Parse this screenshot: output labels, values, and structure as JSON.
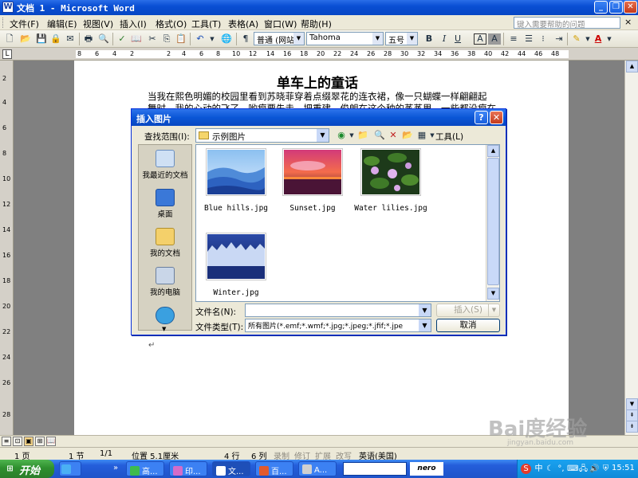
{
  "window": {
    "title": "文档 1 - Microsoft Word"
  },
  "menu": {
    "items": [
      "文件(F)",
      "编辑(E)",
      "视图(V)",
      "插入(I)",
      "格式(O)",
      "工具(T)",
      "表格(A)",
      "窗口(W)",
      "帮助(H)"
    ],
    "help_placeholder": "键入需要帮助的问题",
    "close_glyph": "×"
  },
  "toolbar": {
    "style_value": "普通 (网站)",
    "font_value": "Tahoma",
    "size_value": "五号",
    "bold": "B",
    "italic": "I",
    "underline": "U",
    "char_border": "A",
    "char_shading": "A",
    "font_color": "A"
  },
  "ruler": {
    "box": "L",
    "ticks": [
      "8",
      "6",
      "4",
      "2",
      "2",
      "4",
      "6",
      "8",
      "10",
      "12",
      "14",
      "16",
      "18",
      "20",
      "22",
      "24",
      "26",
      "28",
      "30",
      "32",
      "34",
      "36",
      "38",
      "40",
      "42",
      "44",
      "46",
      "48"
    ],
    "vticks": [
      "2",
      "4",
      "6",
      "8",
      "10",
      "12",
      "14",
      "16",
      "18",
      "20",
      "22",
      "24",
      "26",
      "28"
    ]
  },
  "document": {
    "title": "单车上的童话",
    "paragraph_line1": "当我在熙色明媚的校园里看到苏晓菲穿着点缀翠花的连衣裙，像一只蝴蝶一样翩翩起",
    "paragraph_line2": "舞时，我的心动的飞了，哟瘦要先走，把重建，俊朗在这个种的蒸蒸里，一些都没瘦在这里瀑",
    "mark": "↵"
  },
  "dialog": {
    "title": "插入图片",
    "help_glyph": "?",
    "close_glyph": "✕",
    "lookin_label": "查找范围(I):",
    "lookin_value": "示例图片",
    "tools_label": "工具(L)",
    "places": [
      {
        "label": "我最近的文档"
      },
      {
        "label": "桌面"
      },
      {
        "label": "我的文档"
      },
      {
        "label": "我的电脑"
      },
      {
        "label": ""
      }
    ],
    "files": [
      {
        "name": "Blue hills.jpg"
      },
      {
        "name": "Sunset.jpg"
      },
      {
        "name": "Water lilies.jpg"
      },
      {
        "name": "Winter.jpg"
      }
    ],
    "filename_label": "文件名(N):",
    "filename_value": "",
    "filetype_label": "文件类型(T):",
    "filetype_value": "所有图片(*.emf;*.wmf;*.jpg;*.jpeg;*.jfif;*.jpe",
    "insert_button": "插入(S)",
    "cancel_button": "取消"
  },
  "statusbar": {
    "page": "1 页",
    "section": "1 节",
    "pages": "1/1",
    "position": "位置 5.1厘米",
    "line": "4 行",
    "column": "6 列",
    "rec": "录制",
    "trk": "修订",
    "ext": "扩展",
    "ovr": "改写",
    "language": "英语(美国)"
  },
  "taskbar": {
    "start": "开始",
    "tasks": [
      {
        "label": "高..."
      },
      {
        "label": "印..."
      },
      {
        "label": "文..."
      },
      {
        "label": "百..."
      },
      {
        "label": "A..."
      }
    ],
    "nero": "nero",
    "clock": "15:51"
  },
  "watermark": {
    "text": "Bai度经验",
    "sub": "jingyan.baidu.com"
  }
}
